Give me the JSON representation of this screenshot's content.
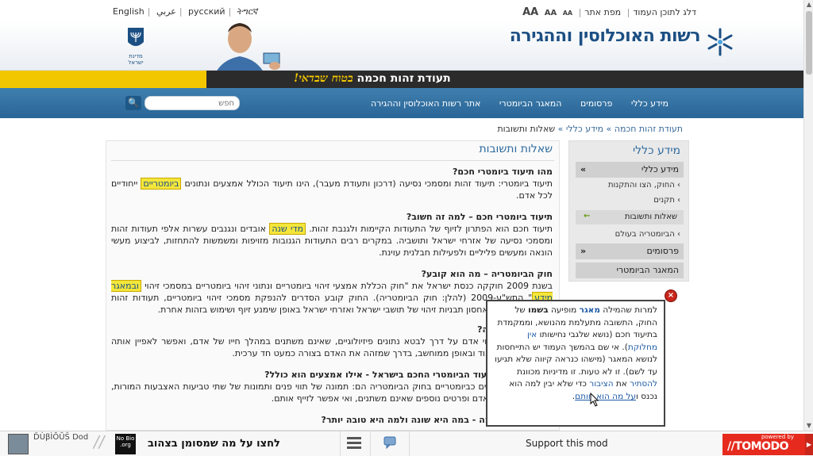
{
  "languages": [
    "English",
    "عربي",
    "русский",
    "ትግርኛ"
  ],
  "accessibility": {
    "skip_link": "דלג לתוכן העמוד",
    "sitemap": "מפת אתר",
    "font_lg": "AA",
    "font_md": "AA",
    "font_sm": "AA"
  },
  "header": {
    "brand": "רשות האוכלוסין וההגירה",
    "emblem_label": "מדינת ישראל"
  },
  "banner": {
    "main": "תעודת זהות חכמה",
    "hand": "בטוח שבדאי!"
  },
  "nav": {
    "items": [
      "מידע כללי",
      "פרסומים",
      "המאגר הביומטרי",
      "אתר רשות האוכלוסין וההגירה"
    ],
    "search_placeholder": "חפש",
    "search_button": "🔍"
  },
  "breadcrumb": {
    "item1": "תעודת זהות חכמה",
    "sep": " » ",
    "item2": "מידע כללי",
    "current": "שאלות ותשובות"
  },
  "content": {
    "title": "שאלות ותשובות",
    "q1": "מהו תיעוד ביומטרי חכם?",
    "a1a": "תיעוד ביומטרי: תיעוד זהות ומסמכי נסיעה (דרכון ותעודת מעבר), הינו תיעוד הכולל אמצעים ונתונים",
    "a1_hl": "ביומטריים",
    "a1b": " ייחודיים לכל אדם.",
    "q2": "תיעוד ביומטרי חכם – למה זה חשוב?",
    "a2a": "תיעוד חכם הוא הפתרון לזיוף של התעודות הקיימות ולגנבת זהות. ",
    "a2_hl": "מדי שנה",
    "a2b": " אובדים ונגנבים עשרות אלפי תעודות זהות ומסמכי נסיעה של אזרחי ישראל ותושביה. במקרים רבים התעודות הגנובות מזויפות ומשמשות להתחזות, לביצוע מעשי הונאה ומעשים פליליים ולפעילות חבלנית עוינת.",
    "q3": "חוק הביומטריה – מה הוא קובע?",
    "a3a": "בשנת 2009 חוקקה כנסת ישראל את \"חוק הכללת אמצעי זיהוי ביומטריים ונתוני זיהוי ביומטריים במסמכי זיהוי",
    "a3_hl": "ובמאגר מידע",
    "a3b": "\" התש\"ע-2009 (להלן: חוק הביומטריה). החוק קובע הסדרים להנפקת מסמכי זיהוי ביומטריים, תעודות זהות ומסמכי נסיעה, ולאחסון תבניות זיהוי של תושבי ישראל ואזרחי ישראל באופן שימנע זיוף ושימוש בזהות אחרת.",
    "q4": "מה היא ביומטריה?",
    "a4": "ביומטריה היא זיהוי אדם על דרך לבטא נתונים פיזיולוגיים, שאינם משתנים במהלך חייו של אדם, ואפשר לאפיין אותה בצורה מדויקת מאוד ובאופן ממוחשב, בדרך שמזהה את האדם בצורה כמעט חד ערכית.",
    "q5": "מהם אמצעי התיעוד הביומטרי החכם בישראל - אילו אמצעים הוא כולל?",
    "a5": "האמצעים המוגדרים כביומטריים בחוק הביומטריה הם: תמונה של תווי פנים ותמונות של שתי טביעות האצבעות המורות, שהן ייחודיות לכל אדם ופרטים נוספים שאינם משתנים, ואי אפשר לזייף אותם.",
    "q6": "תעודת זהות חכמה - במה היא שונה ולמה היא טובה יותר?"
  },
  "sidebar": {
    "title": "מידע כללי",
    "section1": "מידע כללי",
    "sub1": "החוק, הצו והתקנות",
    "sub2": "תקנים",
    "active": "שאלות ותשובות",
    "sub3": "הביומטריה בעולם",
    "section2": "פרסומים",
    "section3": "המאגר הביומטרי"
  },
  "popup": {
    "t1": "למרות שהמילה ",
    "w1": "מאגר",
    "t2": " מופיעה ",
    "w2": "בשמו",
    "t3": " של החוק, התשובה מתעלמת מהנושא, וממקמדת בתיעוד חכם (נושא שלגבי נחישותו ",
    "w3": "אין מחלוקת",
    "t4": "). אי שם בהמשך העמוד יש התייחסות לנושא המאגר (מישהו כנראה קיווה שלא תגיעו עד לשם). זו לא טעות. זו מדיניות מכוונת ",
    "w4": "להסתיר",
    "t5": " את ",
    "w5": "הציבור",
    "t6": " כדי שלא יבין למה הוא נכנס ו",
    "w6": "על מה הוא חותם",
    "t7": ".",
    "close": "×"
  },
  "toolbar": {
    "user": "ĎÙβÌŎŬŠ Dod",
    "nobio": "No Bio .org",
    "message": "לחצו על מה שמסומן בצהוב",
    "support": "Support this mod",
    "powered": "powered by",
    "brand": "//TOMODO",
    "arrow": "▶"
  },
  "colors": {
    "brand_blue": "#1c4f83",
    "nav_blue": "#2a6597",
    "highlight_yellow": "#f4e63a",
    "tomodo_red": "#e62b1e"
  }
}
